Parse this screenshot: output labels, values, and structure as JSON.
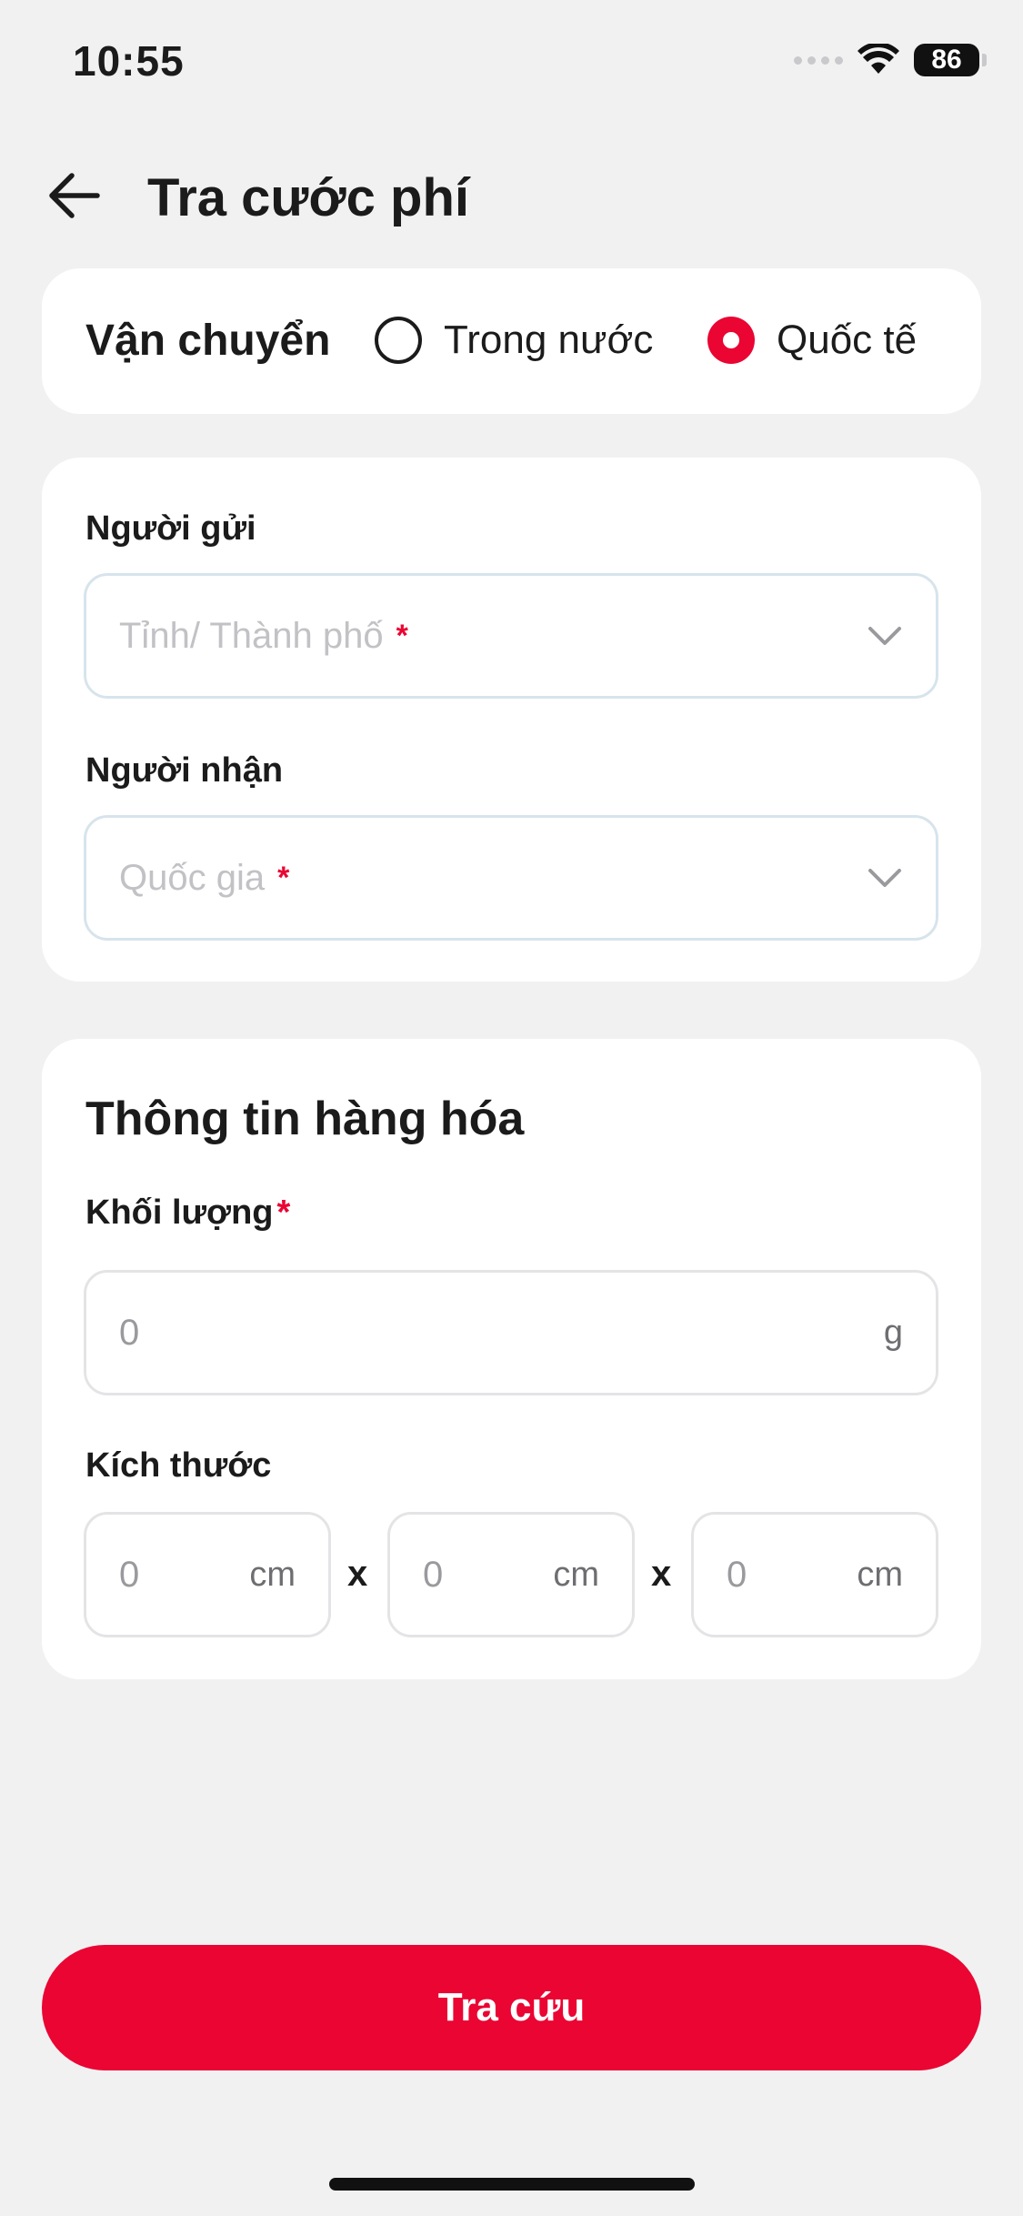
{
  "status_bar": {
    "time": "10:55",
    "battery": "86"
  },
  "header": {
    "title": "Tra cước phí",
    "back_icon": "arrow-left-icon"
  },
  "shipping": {
    "label": "Vận chuyển",
    "options": [
      {
        "label": "Trong nước",
        "selected": false
      },
      {
        "label": "Quốc tế",
        "selected": true
      }
    ]
  },
  "route": {
    "sender_label": "Người gửi",
    "sender_placeholder": "Tỉnh/ Thành phố",
    "receiver_label": "Người nhận",
    "receiver_placeholder": "Quốc gia",
    "required_mark": "*"
  },
  "goods": {
    "title": "Thông tin hàng hóa",
    "weight_label": "Khối lượng",
    "weight_value": "0",
    "weight_unit": "g",
    "size_label": "Kích thước",
    "dimensions": [
      {
        "value": "0",
        "unit": "cm"
      },
      {
        "value": "0",
        "unit": "cm"
      },
      {
        "value": "0",
        "unit": "cm"
      }
    ],
    "separator": "x"
  },
  "actions": {
    "submit_label": "Tra cứu"
  },
  "colors": {
    "accent": "#ea0533",
    "background": "#f1f1f2",
    "card": "#ffffff"
  }
}
